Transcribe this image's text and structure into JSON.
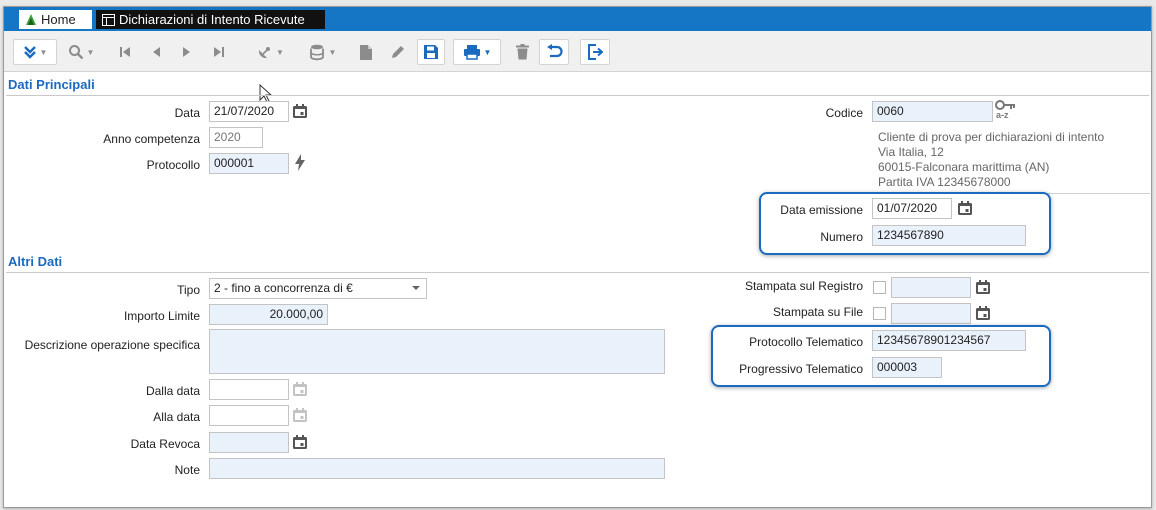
{
  "tabs": {
    "home": "Home",
    "document": "Dichiarazioni di Intento Ricevute"
  },
  "sections": {
    "principali": "Dati Principali",
    "altri": "Altri Dati"
  },
  "labels": {
    "data": "Data",
    "anno": "Anno competenza",
    "protocollo": "Protocollo",
    "codice": "Codice",
    "data_emissione": "Data emissione",
    "numero": "Numero",
    "tipo": "Tipo",
    "importo": "Importo Limite",
    "descrizione": "Descrizione operazione specifica",
    "dalla": "Dalla data",
    "alla": "Alla data",
    "revoca": "Data Revoca",
    "note": "Note",
    "stampata_registro": "Stampata sul Registro",
    "stampata_file": "Stampata su File",
    "prot_tel": "Protocollo Telematico",
    "prog_tel": "Progressivo Telematico"
  },
  "values": {
    "data": "21/07/2020",
    "anno": "2020",
    "protocollo": "000001",
    "codice": "0060",
    "data_emissione": "01/07/2020",
    "numero": "1234567890",
    "tipo": "2 - fino a concorrenza di €",
    "importo": "20.000,00",
    "prot_tel": "12345678901234567",
    "prog_tel": "000003"
  },
  "cliente": {
    "line1": "Cliente di prova per dichiarazioni di intento",
    "line2": "Via Italia, 12",
    "line3": "60015-Falconara marittima (AN)",
    "line4": "Partita IVA 12345678000"
  },
  "icons": {
    "az": "a-z"
  },
  "colors": {
    "accent": "#1a6ac0",
    "tabbar": "#1676c6",
    "input_bg": "#e9f1fb"
  }
}
